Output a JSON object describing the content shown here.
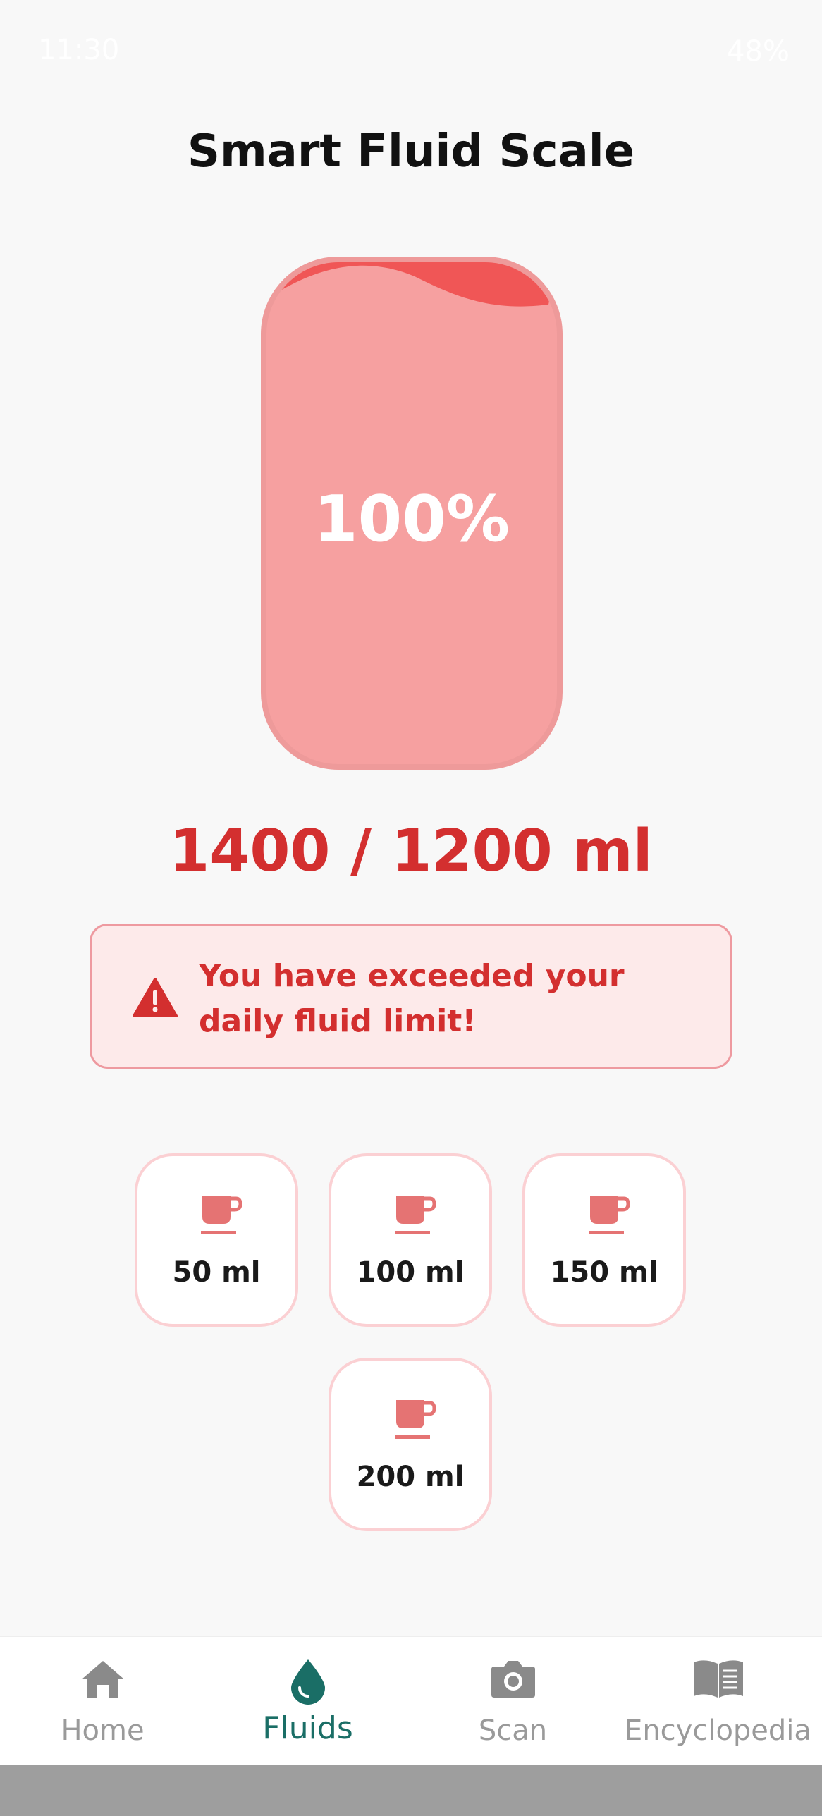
{
  "status_bar": {
    "time": "11:30",
    "battery": "48%"
  },
  "header": {
    "title": "Smart Fluid Scale"
  },
  "bottle": {
    "percent_text": "100%",
    "fill_fraction": 1.0
  },
  "intake": {
    "text": "1400 / 1200 ml"
  },
  "alert": {
    "message": "You have exceeded your daily fluid limit!",
    "icon": "warning-icon"
  },
  "quick_add": [
    {
      "label": "50 ml",
      "icon": "cup-icon"
    },
    {
      "label": "100 ml",
      "icon": "cup-icon"
    },
    {
      "label": "150 ml",
      "icon": "cup-icon"
    },
    {
      "label": "200 ml",
      "icon": "cup-icon"
    }
  ],
  "bottom_nav": {
    "items": [
      {
        "label": "Home",
        "icon": "home-icon"
      },
      {
        "label": "Fluids",
        "icon": "droplet-icon",
        "active": true
      },
      {
        "label": "Scan",
        "icon": "camera-icon"
      },
      {
        "label": "Encyclopedia",
        "icon": "book-icon"
      }
    ]
  },
  "colors": {
    "accent_red": "#d32f2f",
    "bottle_fill": "#f6a0a0",
    "wave": "#f05656",
    "nav_active": "#1a6e66",
    "nav_inactive": "#9a9a9a"
  }
}
